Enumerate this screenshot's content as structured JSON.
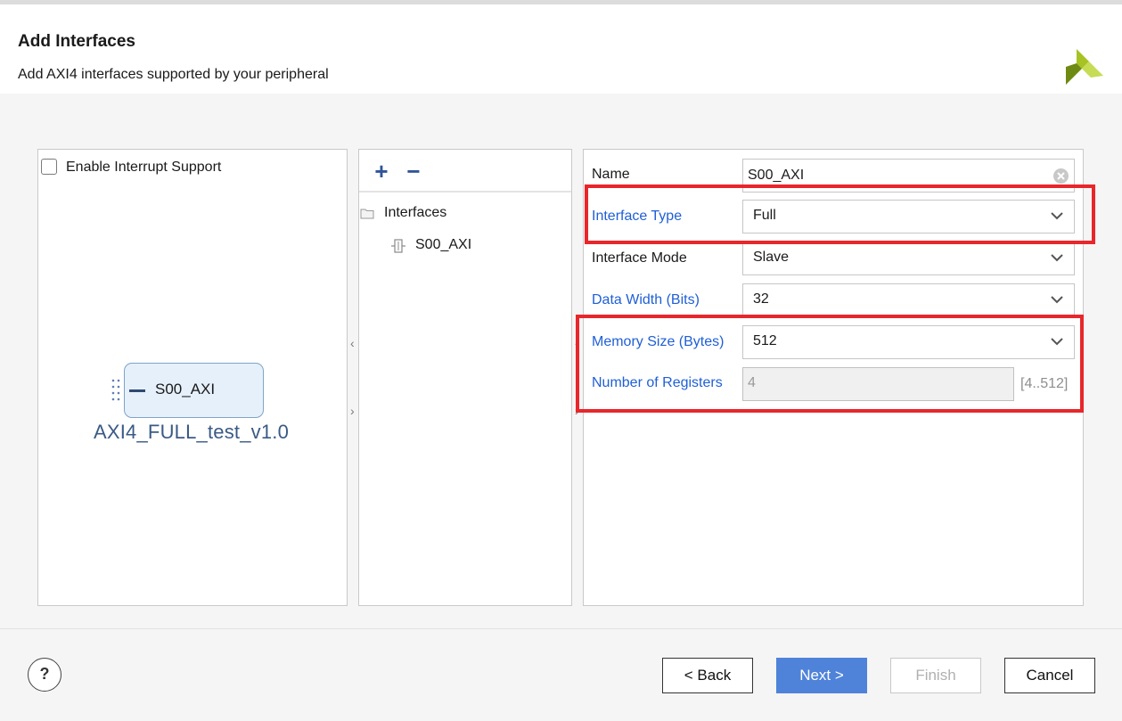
{
  "header": {
    "title": "Add Interfaces",
    "subtitle": "Add AXI4 interfaces supported by your peripheral",
    "logo_icon": "xilinx-logo-icon"
  },
  "left": {
    "interrupt_checkbox_label": "Enable Interrupt Support",
    "interrupt_checked": false,
    "ip_interface_label": "S00_AXI",
    "ip_name": "AXI4_FULL_test_v1.0"
  },
  "middle": {
    "add_label": "+",
    "remove_label": "−",
    "tree_root": "Interfaces",
    "tree_items": [
      "S00_AXI"
    ]
  },
  "right": {
    "name_label": "Name",
    "name_value": "S00_AXI",
    "interface_type_label": "Interface Type",
    "interface_type_value": "Full",
    "interface_mode_label": "Interface Mode",
    "interface_mode_value": "Slave",
    "data_width_label": "Data Width (Bits)",
    "data_width_value": "32",
    "memory_size_label": "Memory Size (Bytes)",
    "memory_size_value": "512",
    "num_registers_label": "Number of Registers",
    "num_registers_value": "4",
    "num_registers_range": "[4..512]"
  },
  "footer": {
    "help_label": "?",
    "back_label": "< Back",
    "next_label": "Next >",
    "finish_label": "Finish",
    "cancel_label": "Cancel"
  },
  "colors": {
    "accent_blue": "#1f5fd6",
    "primary_button": "#4f83d9",
    "highlight_red": "#e8262b",
    "logo_green": "#7d9b14"
  }
}
